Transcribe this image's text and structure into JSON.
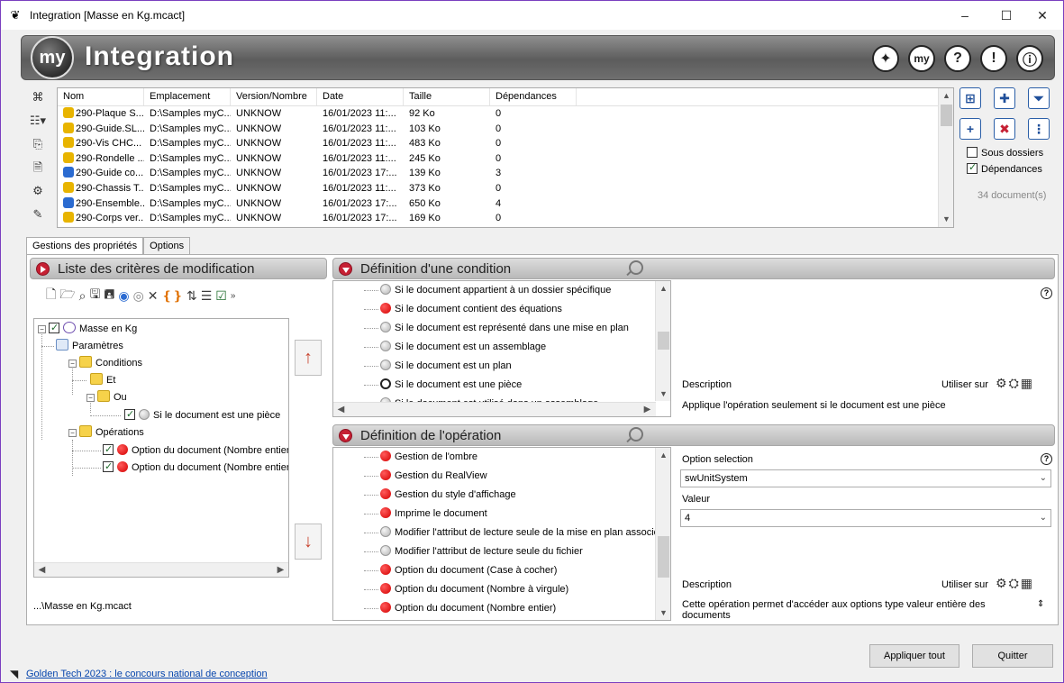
{
  "window": {
    "title": "Integration [Masse en Kg.mcact]",
    "minimize": "–",
    "maximize": "☐",
    "close": "✕"
  },
  "banner": {
    "logo": "my",
    "title": "Integration",
    "buttons": [
      "✦",
      "my",
      "?",
      "!",
      "ⓘ"
    ]
  },
  "file_list": {
    "columns": [
      "Nom",
      "Emplacement",
      "Version/Nombre",
      "Date",
      "Taille",
      "Dépendances"
    ],
    "rows": [
      {
        "name": "290-Plaque S...",
        "location": "D:\\Samples myC...",
        "version": "UNKNOW",
        "date": "16/01/2023 11:...",
        "size": "92 Ko",
        "deps": "0",
        "type": "part"
      },
      {
        "name": "290-Guide.SL...",
        "location": "D:\\Samples myC...",
        "version": "UNKNOW",
        "date": "16/01/2023 11:...",
        "size": "103 Ko",
        "deps": "0",
        "type": "part"
      },
      {
        "name": "290-Vis CHC...",
        "location": "D:\\Samples myC...",
        "version": "UNKNOW",
        "date": "16/01/2023 11:...",
        "size": "483 Ko",
        "deps": "0",
        "type": "part"
      },
      {
        "name": "290-Rondelle ...",
        "location": "D:\\Samples myC...",
        "version": "UNKNOW",
        "date": "16/01/2023 11:...",
        "size": "245 Ko",
        "deps": "0",
        "type": "part"
      },
      {
        "name": "290-Guide co...",
        "location": "D:\\Samples myC...",
        "version": "UNKNOW",
        "date": "16/01/2023 17:...",
        "size": "139 Ko",
        "deps": "3",
        "type": "assembly"
      },
      {
        "name": "290-Chassis T...",
        "location": "D:\\Samples myC...",
        "version": "UNKNOW",
        "date": "16/01/2023 11:...",
        "size": "373 Ko",
        "deps": "0",
        "type": "part"
      },
      {
        "name": "290-Ensemble...",
        "location": "D:\\Samples myC...",
        "version": "UNKNOW",
        "date": "16/01/2023 17:...",
        "size": "650 Ko",
        "deps": "4",
        "type": "assembly"
      },
      {
        "name": "290-Corps ver...",
        "location": "D:\\Samples myC...",
        "version": "UNKNOW",
        "date": "16/01/2023 17:...",
        "size": "169 Ko",
        "deps": "0",
        "type": "part"
      }
    ]
  },
  "options": {
    "sub_folders": "Sous dossiers",
    "sub_folders_checked": false,
    "dependencies": "Dépendances",
    "dependencies_checked": true,
    "doc_count": "34 document(s)"
  },
  "tabs": [
    {
      "label": "Gestions des propriétés",
      "active": true
    },
    {
      "label": "Options",
      "active": false
    }
  ],
  "criteria": {
    "title": "Liste des critères de modification",
    "tree": {
      "root": "Masse en Kg",
      "params": "Paramètres",
      "conditions": "Conditions",
      "and": "Et",
      "or": "Ou",
      "cond_item": "Si le document est une pièce",
      "operations": "Opérations",
      "op1": "Option du document (Nombre entier)",
      "op2": "Option du document (Nombre entier)"
    },
    "file": "...\\Masse en Kg.mcact"
  },
  "condition_def": {
    "title": "Définition d'une condition",
    "items": [
      {
        "label": "Si le document appartient à un dossier spécifique",
        "state": "gray"
      },
      {
        "label": "Si le document contient des équations",
        "state": "red"
      },
      {
        "label": "Si le document est représenté dans une mise en plan",
        "state": "gray"
      },
      {
        "label": "Si le document est un assemblage",
        "state": "gray"
      },
      {
        "label": "Si le document est un plan",
        "state": "gray"
      },
      {
        "label": "Si le document est une pièce",
        "state": "ring"
      },
      {
        "label": "Si le document est utilisé dans un assemblage",
        "state": "gray"
      }
    ],
    "description_label": "Description",
    "use_on": "Utiliser sur",
    "description": "Applique l'opération seulement si le document est une pièce"
  },
  "operation_def": {
    "title": "Définition de l'opération",
    "items": [
      {
        "label": "Gestion de l'ombre",
        "state": "red"
      },
      {
        "label": "Gestion du RealView",
        "state": "red"
      },
      {
        "label": "Gestion du style d'affichage",
        "state": "red"
      },
      {
        "label": "Imprime le document",
        "state": "red"
      },
      {
        "label": "Modifier l'attribut de lecture seule de la mise en plan associée",
        "state": "gray"
      },
      {
        "label": "Modifier l'attribut de lecture seule du fichier",
        "state": "gray"
      },
      {
        "label": "Option du document (Case à cocher)",
        "state": "red"
      },
      {
        "label": "Option du document (Nombre à virgule)",
        "state": "red"
      },
      {
        "label": "Option du document (Nombre entier)",
        "state": "red"
      }
    ],
    "option_selection_label": "Option selection",
    "option_selection_value": "swUnitSystem",
    "value_label": "Valeur",
    "value": "4",
    "description_label": "Description",
    "use_on": "Utiliser sur",
    "description": "Cette opération permet d'accéder aux options type valeur entière des documents"
  },
  "buttons": {
    "apply_all": "Appliquer tout",
    "quit": "Quitter"
  },
  "footer": {
    "rss": "Golden Tech 2023 : le concours national de conception"
  }
}
